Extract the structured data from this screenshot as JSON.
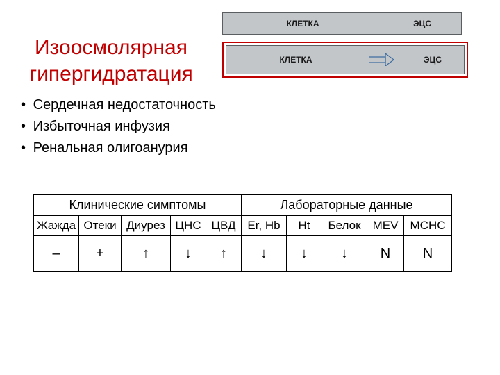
{
  "title_line1": "Изоосмолярная",
  "title_line2": "гипергидратация",
  "bullets": [
    "Сердечная недостаточность",
    "Избыточная инфузия",
    "Ренальная олигоанурия"
  ],
  "diagram": {
    "row1": {
      "cell": "КЛЕТКА",
      "ecs": "ЭЦС"
    },
    "row2": {
      "cell": "КЛЕТКА",
      "ecs": "ЭЦС"
    }
  },
  "table": {
    "group_clinical": "Клинические симптомы",
    "group_lab": "Лабораторные данные",
    "headers": {
      "h0": "Жажда",
      "h1": "Отеки",
      "h2": "Диурез",
      "h3": "ЦНС",
      "h4": "ЦВД",
      "h5": "Er, Hb",
      "h6": "Ht",
      "h7": "Белок",
      "h8": "MEV",
      "h9": "MCHC"
    },
    "values": {
      "v0": "–",
      "v1": "+",
      "v2": "↑",
      "v3": "↓",
      "v4": "↑",
      "v5": "↓",
      "v6": "↓",
      "v7": "↓",
      "v8": "N",
      "v9": "N"
    }
  }
}
